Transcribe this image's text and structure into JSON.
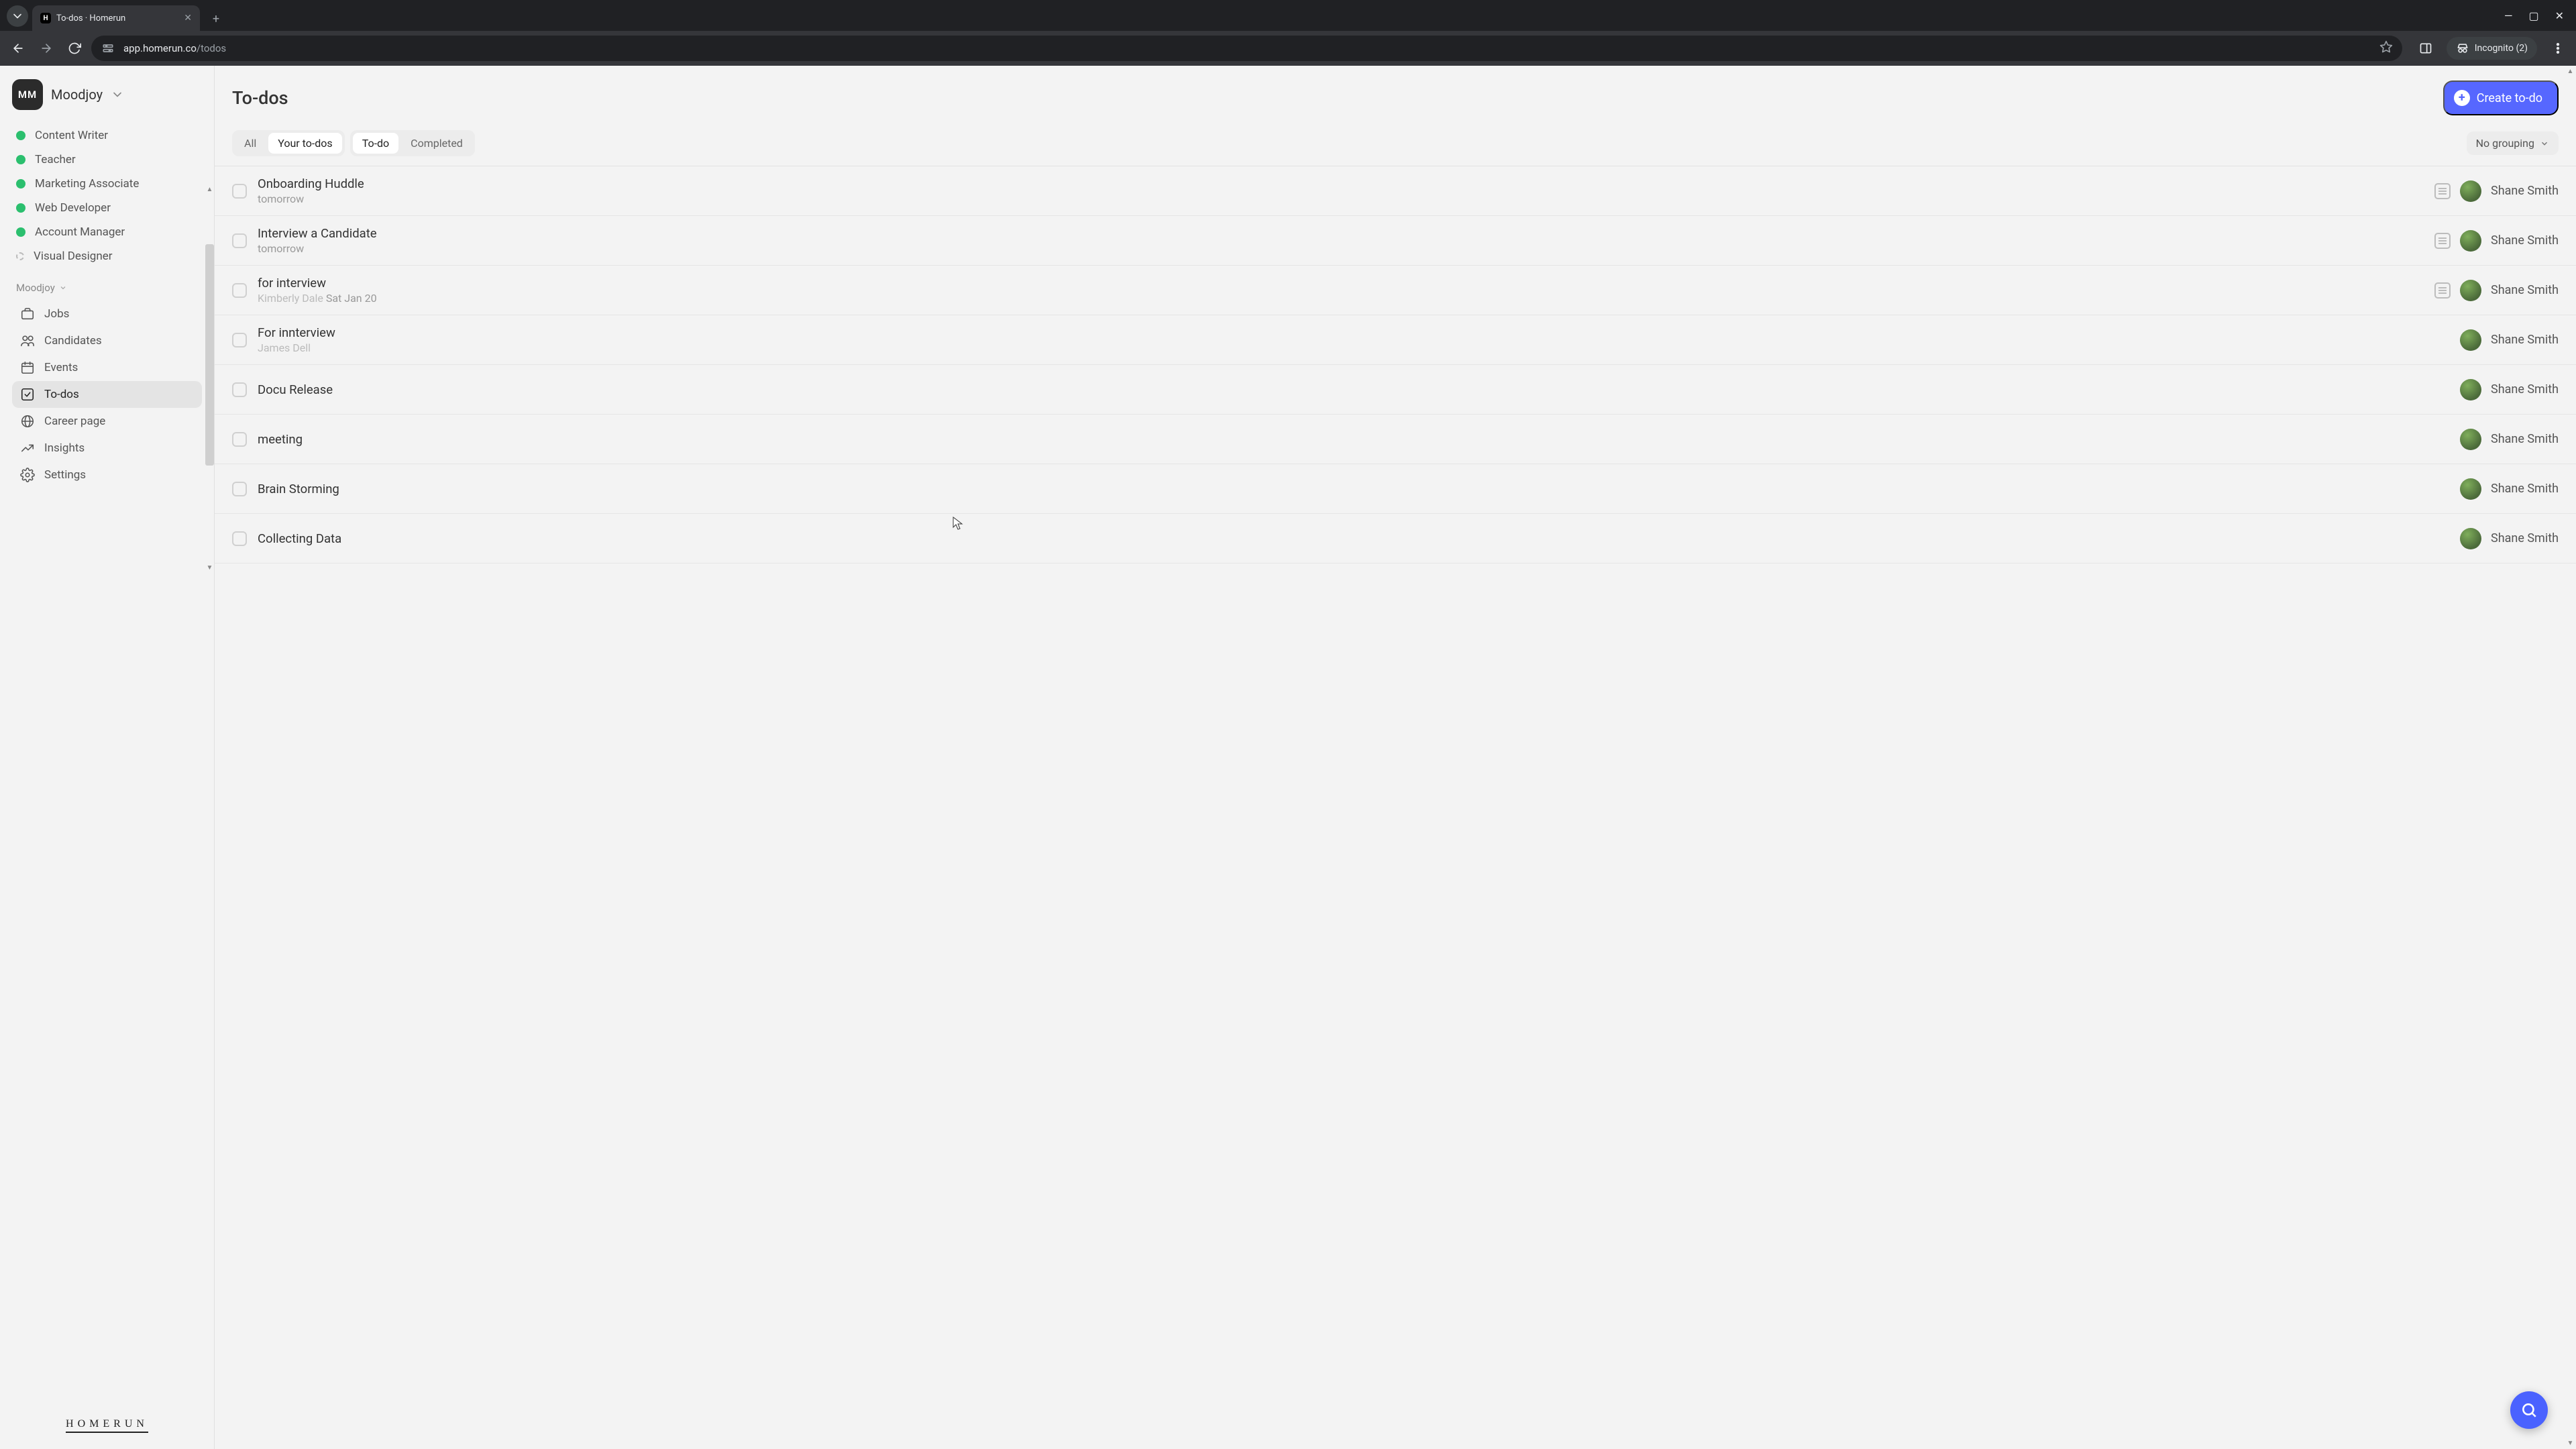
{
  "browser": {
    "tab_title": "To-dos · Homerun",
    "favicon_letter": "H",
    "url_prefix": "app.homerun.co",
    "url_path": "/todos",
    "incognito_label": "Incognito (2)"
  },
  "sidebar": {
    "workspace_initials": "MM",
    "workspace_name": "Moodjoy",
    "positions": [
      {
        "label": "Content Writer",
        "dashed": false
      },
      {
        "label": "Teacher",
        "dashed": false
      },
      {
        "label": "Marketing Associate",
        "dashed": false
      },
      {
        "label": "Web Developer",
        "dashed": false
      },
      {
        "label": "Account Manager",
        "dashed": false
      },
      {
        "label": "Visual Designer",
        "dashed": true
      }
    ],
    "section_label": "Moodjoy",
    "nav": [
      {
        "label": "Jobs",
        "icon": "briefcase",
        "active": false
      },
      {
        "label": "Candidates",
        "icon": "users",
        "active": false
      },
      {
        "label": "Events",
        "icon": "calendar",
        "active": false
      },
      {
        "label": "To-dos",
        "icon": "check-square",
        "active": true
      },
      {
        "label": "Career page",
        "icon": "globe",
        "active": false
      },
      {
        "label": "Insights",
        "icon": "chart",
        "active": false
      },
      {
        "label": "Settings",
        "icon": "gear",
        "active": false
      }
    ],
    "brand": "HOMERUN"
  },
  "header": {
    "title": "To-dos",
    "create_label": "Create to-do"
  },
  "filters": {
    "set1": [
      {
        "label": "All",
        "selected": false
      },
      {
        "label": "Your to-dos",
        "selected": true
      }
    ],
    "set2": [
      {
        "label": "To-do",
        "selected": true
      },
      {
        "label": "Completed",
        "selected": false
      }
    ],
    "grouping_label": "No grouping"
  },
  "todos": [
    {
      "title": "Onboarding Huddle",
      "sub_prefix": "",
      "sub_main": "tomorrow",
      "has_note": true,
      "assignee": "Shane Smith"
    },
    {
      "title": "Interview a Candidate",
      "sub_prefix": "",
      "sub_main": "tomorrow",
      "has_note": true,
      "assignee": "Shane Smith"
    },
    {
      "title": "for interview",
      "sub_prefix": "Kimberly Dale",
      "sub_main": "Sat Jan 20",
      "has_note": true,
      "assignee": "Shane Smith"
    },
    {
      "title": "For innterview",
      "sub_prefix": "James Dell",
      "sub_main": "",
      "has_note": false,
      "assignee": "Shane Smith"
    },
    {
      "title": "Docu Release",
      "sub_prefix": "",
      "sub_main": "",
      "has_note": false,
      "assignee": "Shane Smith"
    },
    {
      "title": "meeting",
      "sub_prefix": "",
      "sub_main": "",
      "has_note": false,
      "assignee": "Shane Smith"
    },
    {
      "title": "Brain Storming",
      "sub_prefix": "",
      "sub_main": "",
      "has_note": false,
      "assignee": "Shane Smith"
    },
    {
      "title": "Collecting Data",
      "sub_prefix": "",
      "sub_main": "",
      "has_note": false,
      "assignee": "Shane Smith"
    }
  ]
}
